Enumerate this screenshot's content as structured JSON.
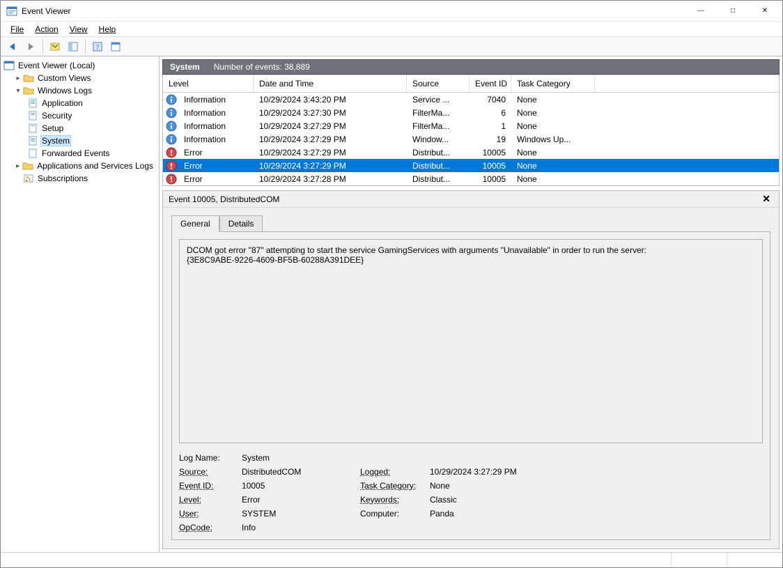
{
  "title": "Event Viewer",
  "menu": {
    "file": "File",
    "action": "Action",
    "view": "View",
    "help": "Help"
  },
  "tree": {
    "root": "Event Viewer (Local)",
    "custom_views": "Custom Views",
    "windows_logs": "Windows Logs",
    "logs": {
      "application": "Application",
      "security": "Security",
      "setup": "Setup",
      "system": "System",
      "forwarded": "Forwarded Events"
    },
    "apps_services": "Applications and Services Logs",
    "subscriptions": "Subscriptions"
  },
  "right_header": {
    "title": "System",
    "count_label": "Number of events: 38,889"
  },
  "grid": {
    "columns": {
      "level": "Level",
      "datetime": "Date and Time",
      "source": "Source",
      "eventid": "Event ID",
      "taskcat": "Task Category"
    },
    "rows": [
      {
        "icon": "info",
        "level": "Information",
        "datetime": "10/29/2024 3:43:20 PM",
        "source": "Service ...",
        "eventid": "7040",
        "taskcat": "None"
      },
      {
        "icon": "info",
        "level": "Information",
        "datetime": "10/29/2024 3:27:30 PM",
        "source": "FilterMa...",
        "eventid": "6",
        "taskcat": "None"
      },
      {
        "icon": "info",
        "level": "Information",
        "datetime": "10/29/2024 3:27:29 PM",
        "source": "FilterMa...",
        "eventid": "1",
        "taskcat": "None"
      },
      {
        "icon": "info",
        "level": "Information",
        "datetime": "10/29/2024 3:27:29 PM",
        "source": "Window...",
        "eventid": "19",
        "taskcat": "Windows Up..."
      },
      {
        "icon": "error",
        "level": "Error",
        "datetime": "10/29/2024 3:27:29 PM",
        "source": "Distribut...",
        "eventid": "10005",
        "taskcat": "None"
      },
      {
        "icon": "error",
        "level": "Error",
        "datetime": "10/29/2024 3:27:29 PM",
        "source": "Distribut...",
        "eventid": "10005",
        "taskcat": "None",
        "selected": true
      },
      {
        "icon": "error",
        "level": "Error",
        "datetime": "10/29/2024 3:27:28 PM",
        "source": "Distribut...",
        "eventid": "10005",
        "taskcat": "None"
      }
    ]
  },
  "detail": {
    "header": "Event 10005, DistributedCOM",
    "tabs": {
      "general": "General",
      "details": "Details"
    },
    "description_line1": "DCOM got error \"87\" attempting to start the service GamingServices with arguments \"Unavailable\" in order to run the server:",
    "description_line2": "{3E8C9ABE-9226-4609-BF5B-60288A391DEE}",
    "meta": {
      "log_name_lbl": "Log Name:",
      "log_name": "System",
      "source_lbl": "Source:",
      "source": "DistributedCOM",
      "logged_lbl": "Logged:",
      "logged": "10/29/2024 3:27:29 PM",
      "event_id_lbl": "Event ID:",
      "event_id": "10005",
      "task_cat_lbl": "Task Category:",
      "task_cat": "None",
      "level_lbl": "Level:",
      "level": "Error",
      "keywords_lbl": "Keywords:",
      "keywords": "Classic",
      "user_lbl": "User:",
      "user": "SYSTEM",
      "computer_lbl": "Computer:",
      "computer": "Panda",
      "opcode_lbl": "OpCode:",
      "opcode": "Info"
    }
  }
}
